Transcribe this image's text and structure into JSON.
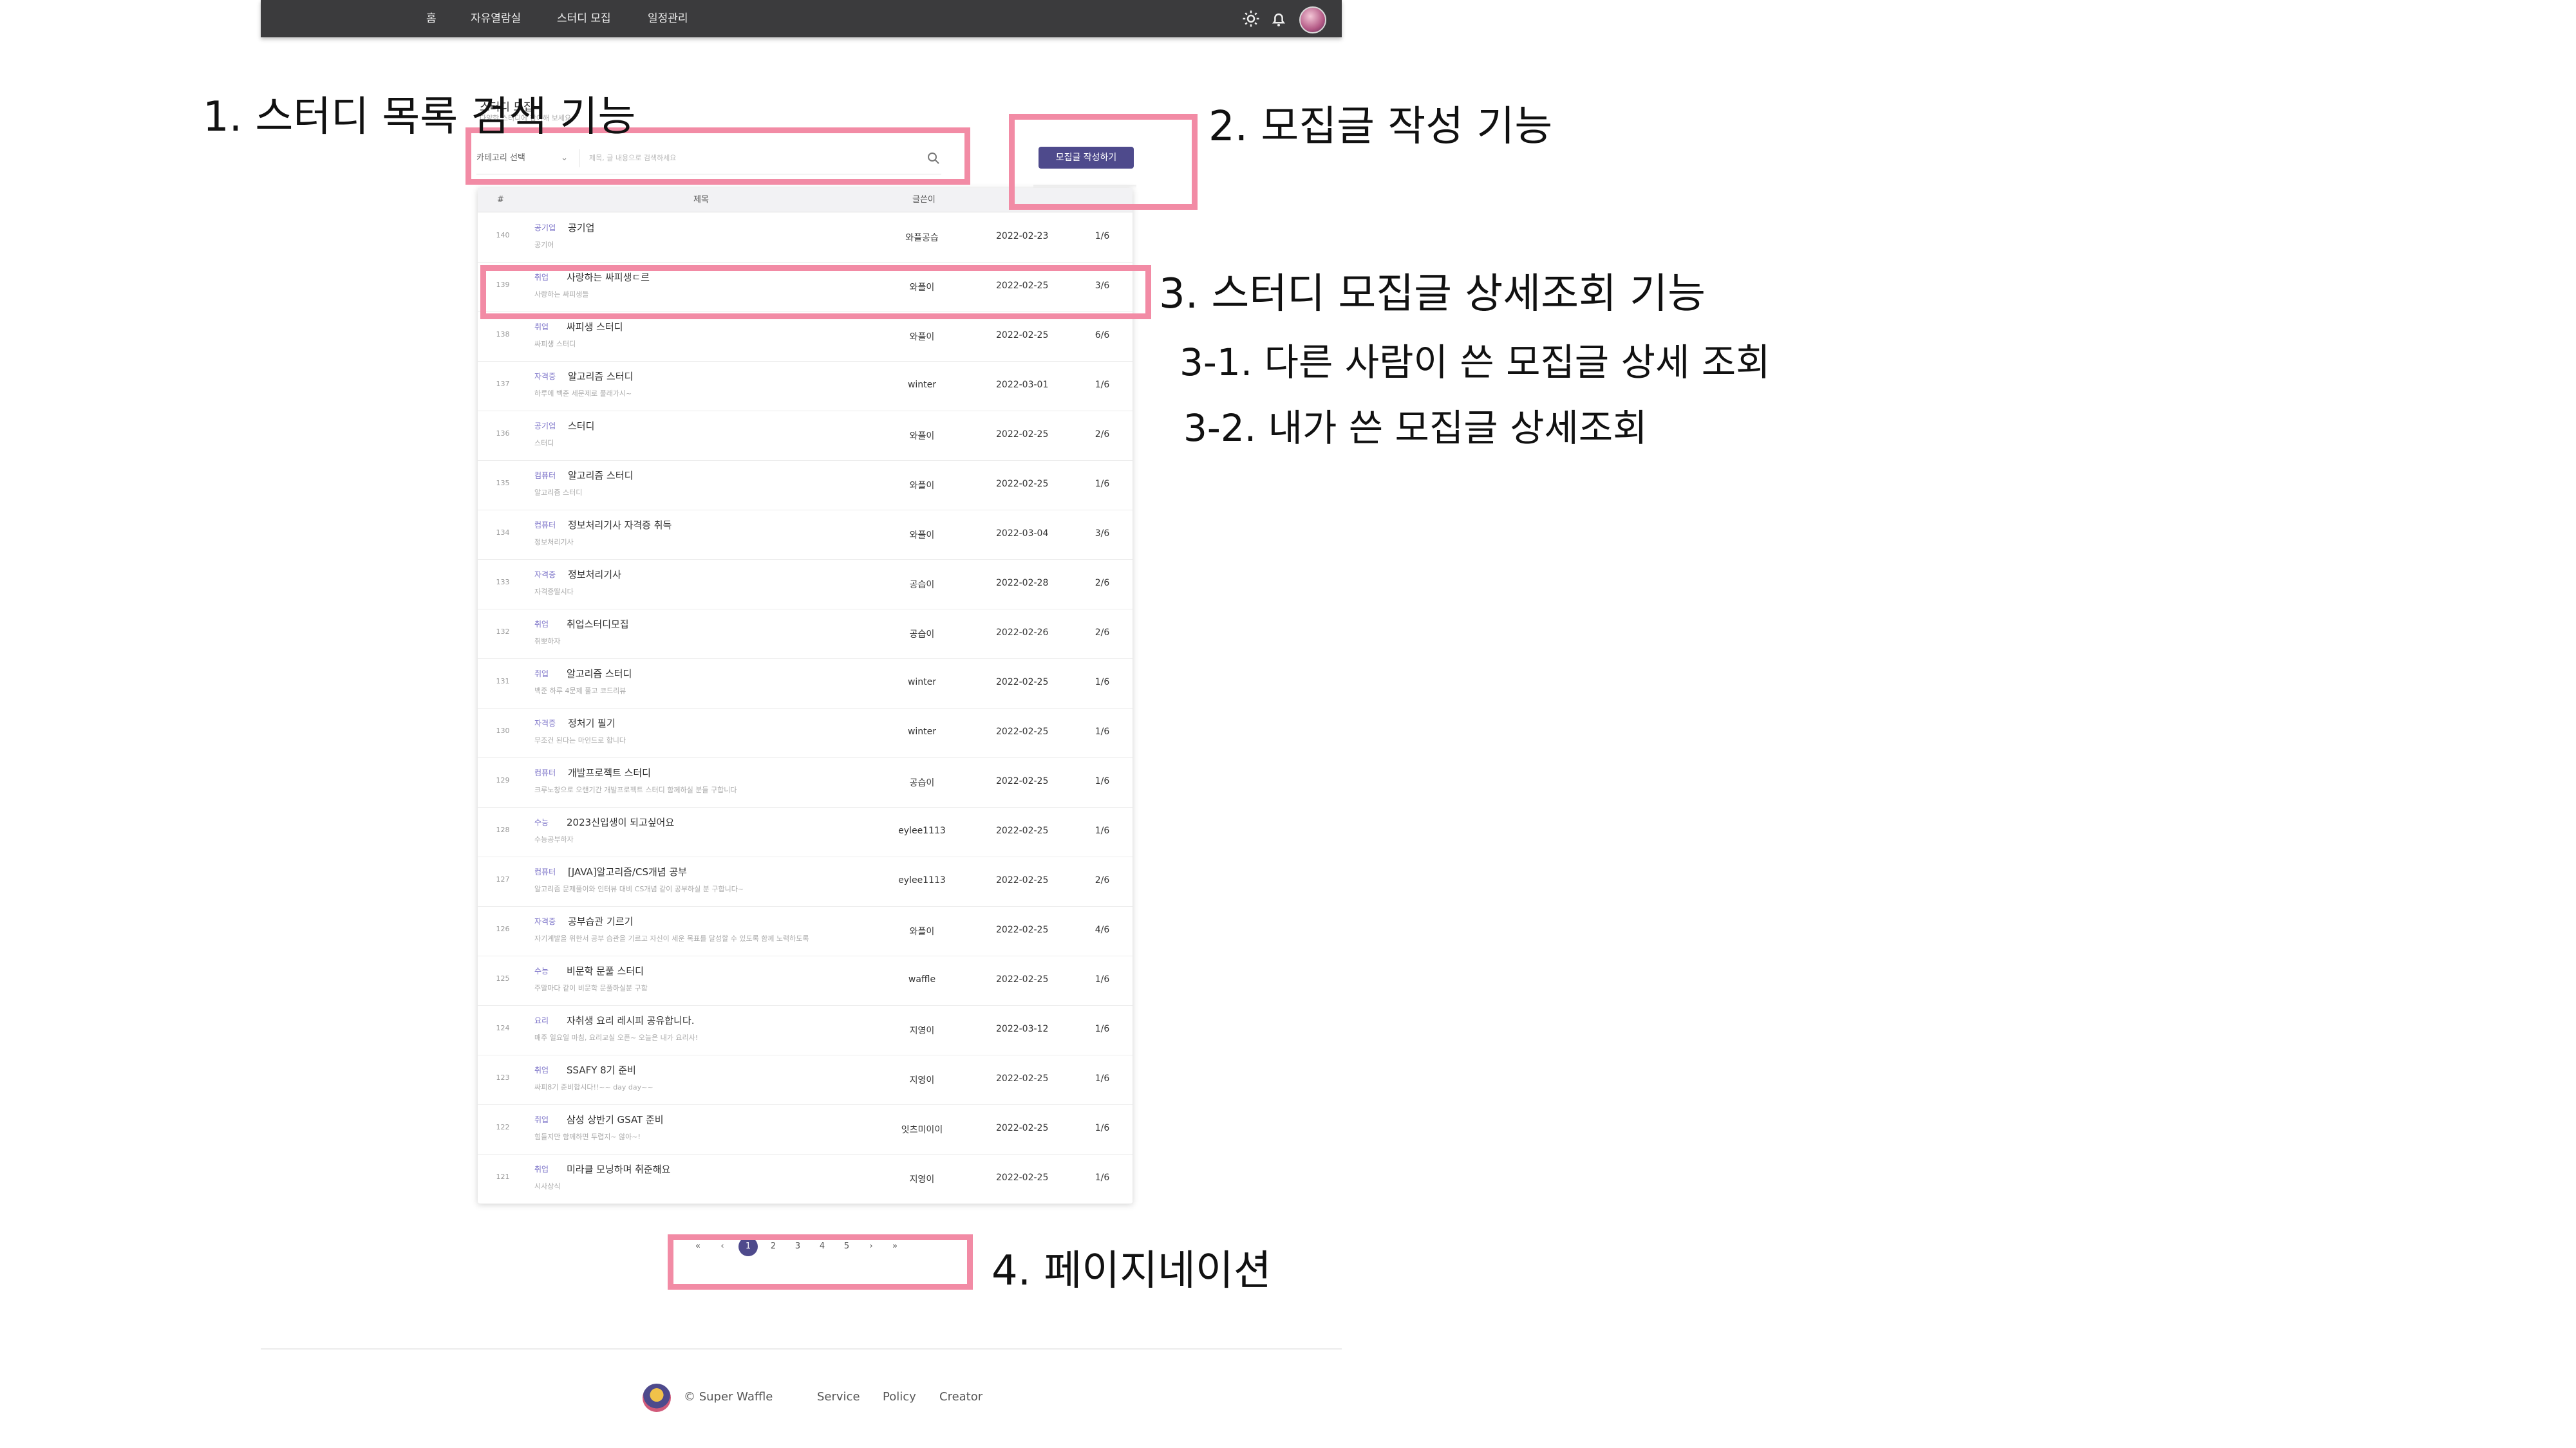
{
  "navbar": {
    "items": [
      "홈",
      "자유열람실",
      "스터디 모집",
      "일정관리"
    ],
    "icons": [
      "sun-icon",
      "bell-icon"
    ]
  },
  "page": {
    "heading": "스터디 모집",
    "subheading": "다양한 스터디에 참여해 보세요"
  },
  "search": {
    "category_placeholder": "카테고리 선택",
    "input_placeholder": "제목, 글 내용으로 검색하세요"
  },
  "write_button": "모집글 작성하기",
  "table": {
    "headers": [
      "#",
      "제목",
      "글쓴이"
    ],
    "rows": [
      {
        "num": "140",
        "cat": "공기업",
        "title": "공기업",
        "desc": "공기어",
        "author": "와플공습",
        "date": "2022-02-23",
        "cap": "1/6"
      },
      {
        "num": "139",
        "cat": "취업",
        "title": "사랑하는 싸피생ㄷ르",
        "desc": "사랑하는 싸피생들",
        "author": "와플이",
        "date": "2022-02-25",
        "cap": "3/6"
      },
      {
        "num": "138",
        "cat": "취업",
        "title": "싸피생 스터디",
        "desc": "싸피생 스터디",
        "author": "와플이",
        "date": "2022-02-25",
        "cap": "6/6"
      },
      {
        "num": "137",
        "cat": "자격증",
        "title": "알고리즘 스터디",
        "desc": "하루에 백준 세문제로 풀래가시~",
        "author": "winter",
        "date": "2022-03-01",
        "cap": "1/6"
      },
      {
        "num": "136",
        "cat": "공기업",
        "title": "스터디",
        "desc": "스터디",
        "author": "와플이",
        "date": "2022-02-25",
        "cap": "2/6"
      },
      {
        "num": "135",
        "cat": "컴퓨터",
        "title": "알고리즘 스터디",
        "desc": "알고리즘 스터디",
        "author": "와플이",
        "date": "2022-02-25",
        "cap": "1/6"
      },
      {
        "num": "134",
        "cat": "컴퓨터",
        "title": "정보처리기사 자격증 취득",
        "desc": "정보처리기사",
        "author": "와플이",
        "date": "2022-03-04",
        "cap": "3/6"
      },
      {
        "num": "133",
        "cat": "자격증",
        "title": "정보처리기사",
        "desc": "자격증딸시다",
        "author": "공습이",
        "date": "2022-02-28",
        "cap": "2/6"
      },
      {
        "num": "132",
        "cat": "취업",
        "title": "취업스터디모집",
        "desc": "취뽀하자",
        "author": "공습이",
        "date": "2022-02-26",
        "cap": "2/6"
      },
      {
        "num": "131",
        "cat": "취업",
        "title": "알고리즘 스터디",
        "desc": "백준 하루 4문제 풀고 코드리뷰",
        "author": "winter",
        "date": "2022-02-25",
        "cap": "1/6"
      },
      {
        "num": "130",
        "cat": "자격증",
        "title": "정처기 필기",
        "desc": "무조건 된다는 마인드로 합니다",
        "author": "winter",
        "date": "2022-02-25",
        "cap": "1/6"
      },
      {
        "num": "129",
        "cat": "컴퓨터",
        "title": "개발프로젝트 스터디",
        "desc": "크루노창으로 오랜기간 개발프로젝트 스터디 함께하실 분들 구합니다",
        "author": "공습이",
        "date": "2022-02-25",
        "cap": "1/6"
      },
      {
        "num": "128",
        "cat": "수능",
        "title": "2023신입생이 되고싶어요",
        "desc": "수능공부하자",
        "author": "eylee1113",
        "date": "2022-02-25",
        "cap": "1/6"
      },
      {
        "num": "127",
        "cat": "컴퓨터",
        "title": "[JAVA]알고리즘/CS개념 공부",
        "desc": "알고리즘 문제풀이와 인터뷰 대비 CS개념 같이 공부하실 분 구합니다~",
        "author": "eylee1113",
        "date": "2022-02-25",
        "cap": "2/6"
      },
      {
        "num": "126",
        "cat": "자격증",
        "title": "공부습관 기르기",
        "desc": "자기계발을 위한서 공부 습관을 기르고 자신이 세운 목표를 달성할 수 있도록 함께 노력하도록",
        "author": "와플이",
        "date": "2022-02-25",
        "cap": "4/6"
      },
      {
        "num": "125",
        "cat": "수능",
        "title": "비문학 문풀 스터디",
        "desc": "주말마다 같이 비문학 문풀하실분 구함",
        "author": "waffle",
        "date": "2022-02-25",
        "cap": "1/6"
      },
      {
        "num": "124",
        "cat": "요리",
        "title": "자취생 요리 레시피 공유합니다.",
        "desc": "매주 일요일 마침, 요리교실 오픈~ 오늘은 내가 요리사!",
        "author": "지영이",
        "date": "2022-03-12",
        "cap": "1/6"
      },
      {
        "num": "123",
        "cat": "취업",
        "title": "SSAFY 8기 준비",
        "desc": "싸피8기 준비합시다!!~~ day day~~",
        "author": "지영이",
        "date": "2022-02-25",
        "cap": "1/6"
      },
      {
        "num": "122",
        "cat": "취업",
        "title": "삼성 상반기 GSAT 준비",
        "desc": "힘들지만 함께하면 두렵지~ 않아~!",
        "author": "잇츠미이이",
        "date": "2022-02-25",
        "cap": "1/6"
      },
      {
        "num": "121",
        "cat": "취업",
        "title": "미라클 모닝하며 취준해요",
        "desc": "시사상식",
        "author": "지영이",
        "date": "2022-02-25",
        "cap": "1/6"
      }
    ]
  },
  "pagination": {
    "first": "«",
    "prev": "‹",
    "pages": [
      "1",
      "2",
      "3",
      "4",
      "5"
    ],
    "next": "›",
    "last": "»",
    "current": "1"
  },
  "footer": {
    "copyright": "© Super Waffle",
    "links": [
      "Service",
      "Policy",
      "Creator"
    ]
  },
  "annotations": {
    "a1": "1. 스터디 목록 검색 기능",
    "a2": "2. 모집글 작성 기능",
    "a3": "3. 스터디 모집글 상세조회 기능",
    "a31": "3-1. 다른 사람이 쓴 모집글 상세 조회",
    "a32": "3-2. 내가 쓴 모집글 상세조회",
    "a4": "4. 페이지네이션"
  },
  "colors": {
    "accent": "#4e4a8c",
    "annotation_box": "#f28ba5",
    "category_text": "#7b72c8"
  }
}
